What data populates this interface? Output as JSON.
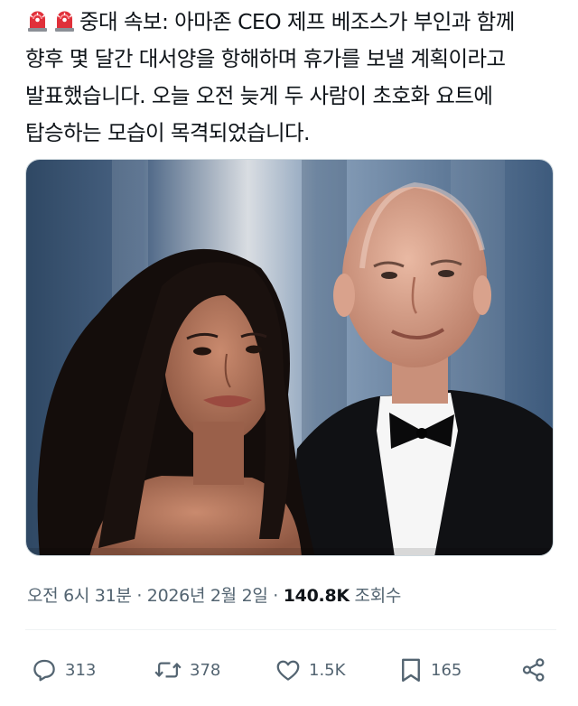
{
  "post": {
    "badge_icons": [
      "siren-icon",
      "siren-icon"
    ],
    "text": "중대 속보: 아마존 CEO 제프 베조스가 부인과 함께 향후 몇 달간 대서양을 항해하며 휴가를 보낼 계획이라고 발표했습니다. 오늘 오전 늦게 두 사람이 초호화 요트에 탑승하는 모습이 목격되었습니다.",
    "image": {
      "icon": "photo",
      "accent_background": "#3e5a78"
    }
  },
  "meta": {
    "time": "오전 6시 31분",
    "separator1": " · ",
    "date": "2026년 2월 2일",
    "separator2": " · ",
    "views_count": "140.8K",
    "views_label": " 조회수"
  },
  "actions": {
    "replies": {
      "icon": "reply-icon",
      "count": "313"
    },
    "reposts": {
      "icon": "repost-icon",
      "count": "378"
    },
    "likes": {
      "icon": "heart-icon",
      "count": "1.5K"
    },
    "bookmarks": {
      "icon": "bookmark-icon",
      "count": "165"
    },
    "share": {
      "icon": "share-icon"
    }
  },
  "colors": {
    "text": "#0f1419",
    "secondary": "#536471",
    "siren_red": "#e0303a"
  }
}
